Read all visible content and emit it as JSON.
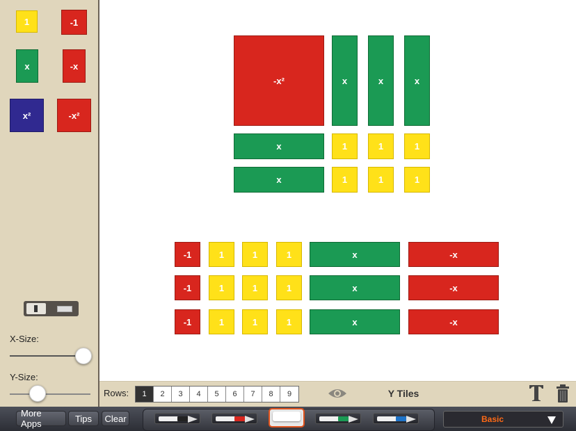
{
  "palette": {
    "one": "1",
    "neg_one": "-1",
    "x": "x",
    "neg_x": "-x",
    "x2": "x²",
    "neg_x2": "-x²"
  },
  "tiles": {
    "unit": "1",
    "neg_unit": "-1",
    "x": "x",
    "neg_x": "-x",
    "neg_x2": "-x²"
  },
  "sliders": {
    "x_label": "X-Size:",
    "y_label": "Y-Size:",
    "x_value": 1.0,
    "y_value": 0.18
  },
  "rows": {
    "label": "Rows:",
    "options": [
      "1",
      "2",
      "3",
      "4",
      "5",
      "6",
      "7",
      "8",
      "9"
    ],
    "selected": "1"
  },
  "header": {
    "title": "Y Tiles"
  },
  "toolbar": {
    "more_apps": "More Apps",
    "tips": "Tips",
    "clear": "Clear",
    "mode": "Basic"
  },
  "colors": {
    "yellow": "#ffe119",
    "red": "#d8261e",
    "green": "#1b9a54",
    "blue": "#302990",
    "mode_text": "#ff6a16"
  },
  "icons": [
    "eye-icon",
    "text-tool-icon",
    "trash-icon",
    "black-pen-icon",
    "red-pen-icon",
    "eraser-icon",
    "green-pen-icon",
    "blue-pen-icon",
    "chevron-down-icon",
    "orientation-toggle-icon"
  ]
}
